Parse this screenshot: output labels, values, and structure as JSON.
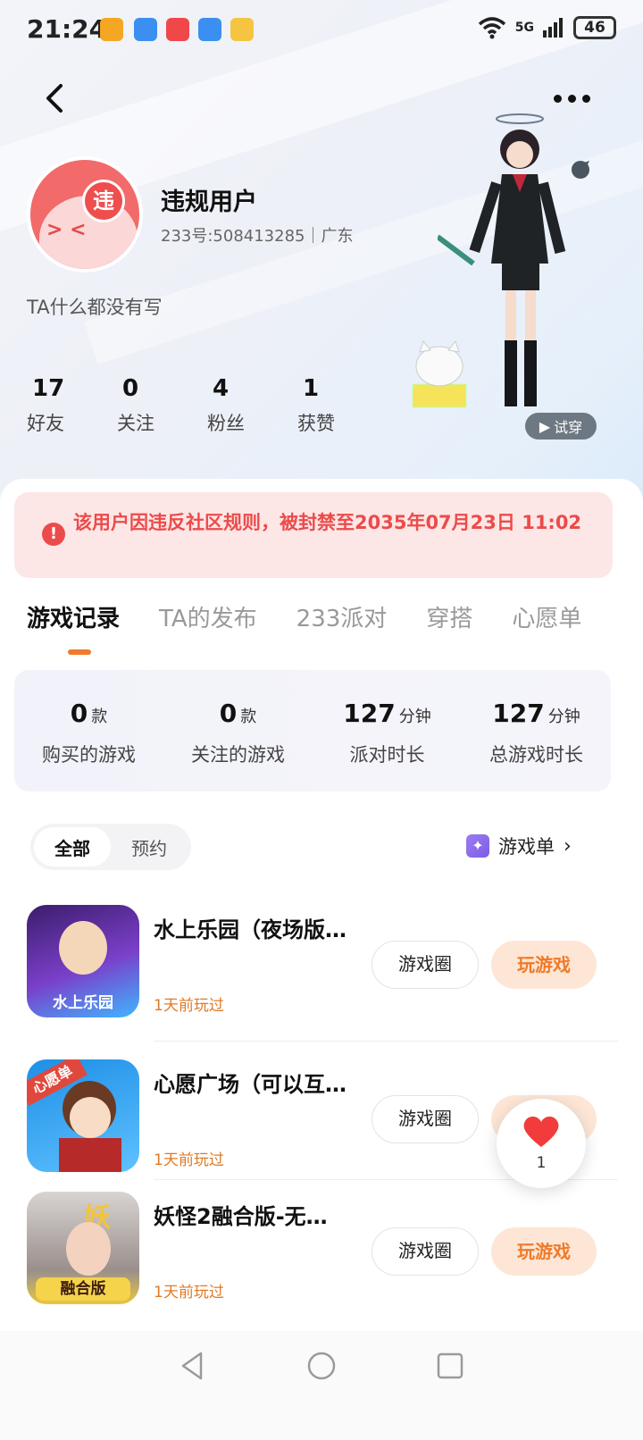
{
  "status_bar": {
    "time": "21:24",
    "network": "5G",
    "battery": "46"
  },
  "profile": {
    "avatar_badge": "违",
    "username": "违规用户",
    "id_location": "233号:508413285｜广东",
    "bio": "TA什么都没有写",
    "stats": [
      {
        "value": "17",
        "label": "好友"
      },
      {
        "value": "0",
        "label": "关注"
      },
      {
        "value": "4",
        "label": "粉丝"
      },
      {
        "value": "1",
        "label": "获赞"
      }
    ],
    "tryon_label": "试穿"
  },
  "ban_notice": "该用户因违反社区规则，被封禁至2035年07月23日 11:02",
  "tabs": [
    "游戏记录",
    "TA的发布",
    "233派对",
    "穿搭",
    "心愿单"
  ],
  "summary": [
    {
      "value": "0",
      "unit": "款",
      "label": "购买的游戏"
    },
    {
      "value": "0",
      "unit": "款",
      "label": "关注的游戏"
    },
    {
      "value": "127",
      "unit": "分钟",
      "label": "派对时长"
    },
    {
      "value": "127",
      "unit": "分钟",
      "label": "总游戏时长"
    }
  ],
  "filter": {
    "options": [
      "全部",
      "预约"
    ],
    "game_list_label": "游戏单"
  },
  "games": [
    {
      "title": "水上乐园（夜场版…",
      "played": "1天前玩过",
      "circle_label": "游戏圈",
      "play_label": "玩游戏",
      "icon_text": "水上乐园"
    },
    {
      "title": "心愿广场（可以互…",
      "played": "1天前玩过",
      "circle_label": "游戏圈",
      "play_label": "玩游戏",
      "icon_text": "心愿单"
    },
    {
      "title": "妖怪2融合版-无…",
      "played": "1天前玩过",
      "circle_label": "游戏圈",
      "play_label": "玩游戏",
      "icon_text": "融合版"
    }
  ],
  "like_fab": {
    "count": "1"
  },
  "colors": {
    "accent": "#f07a2a",
    "ban_red": "#ec4b4b",
    "ban_bg": "#fde7e6"
  }
}
